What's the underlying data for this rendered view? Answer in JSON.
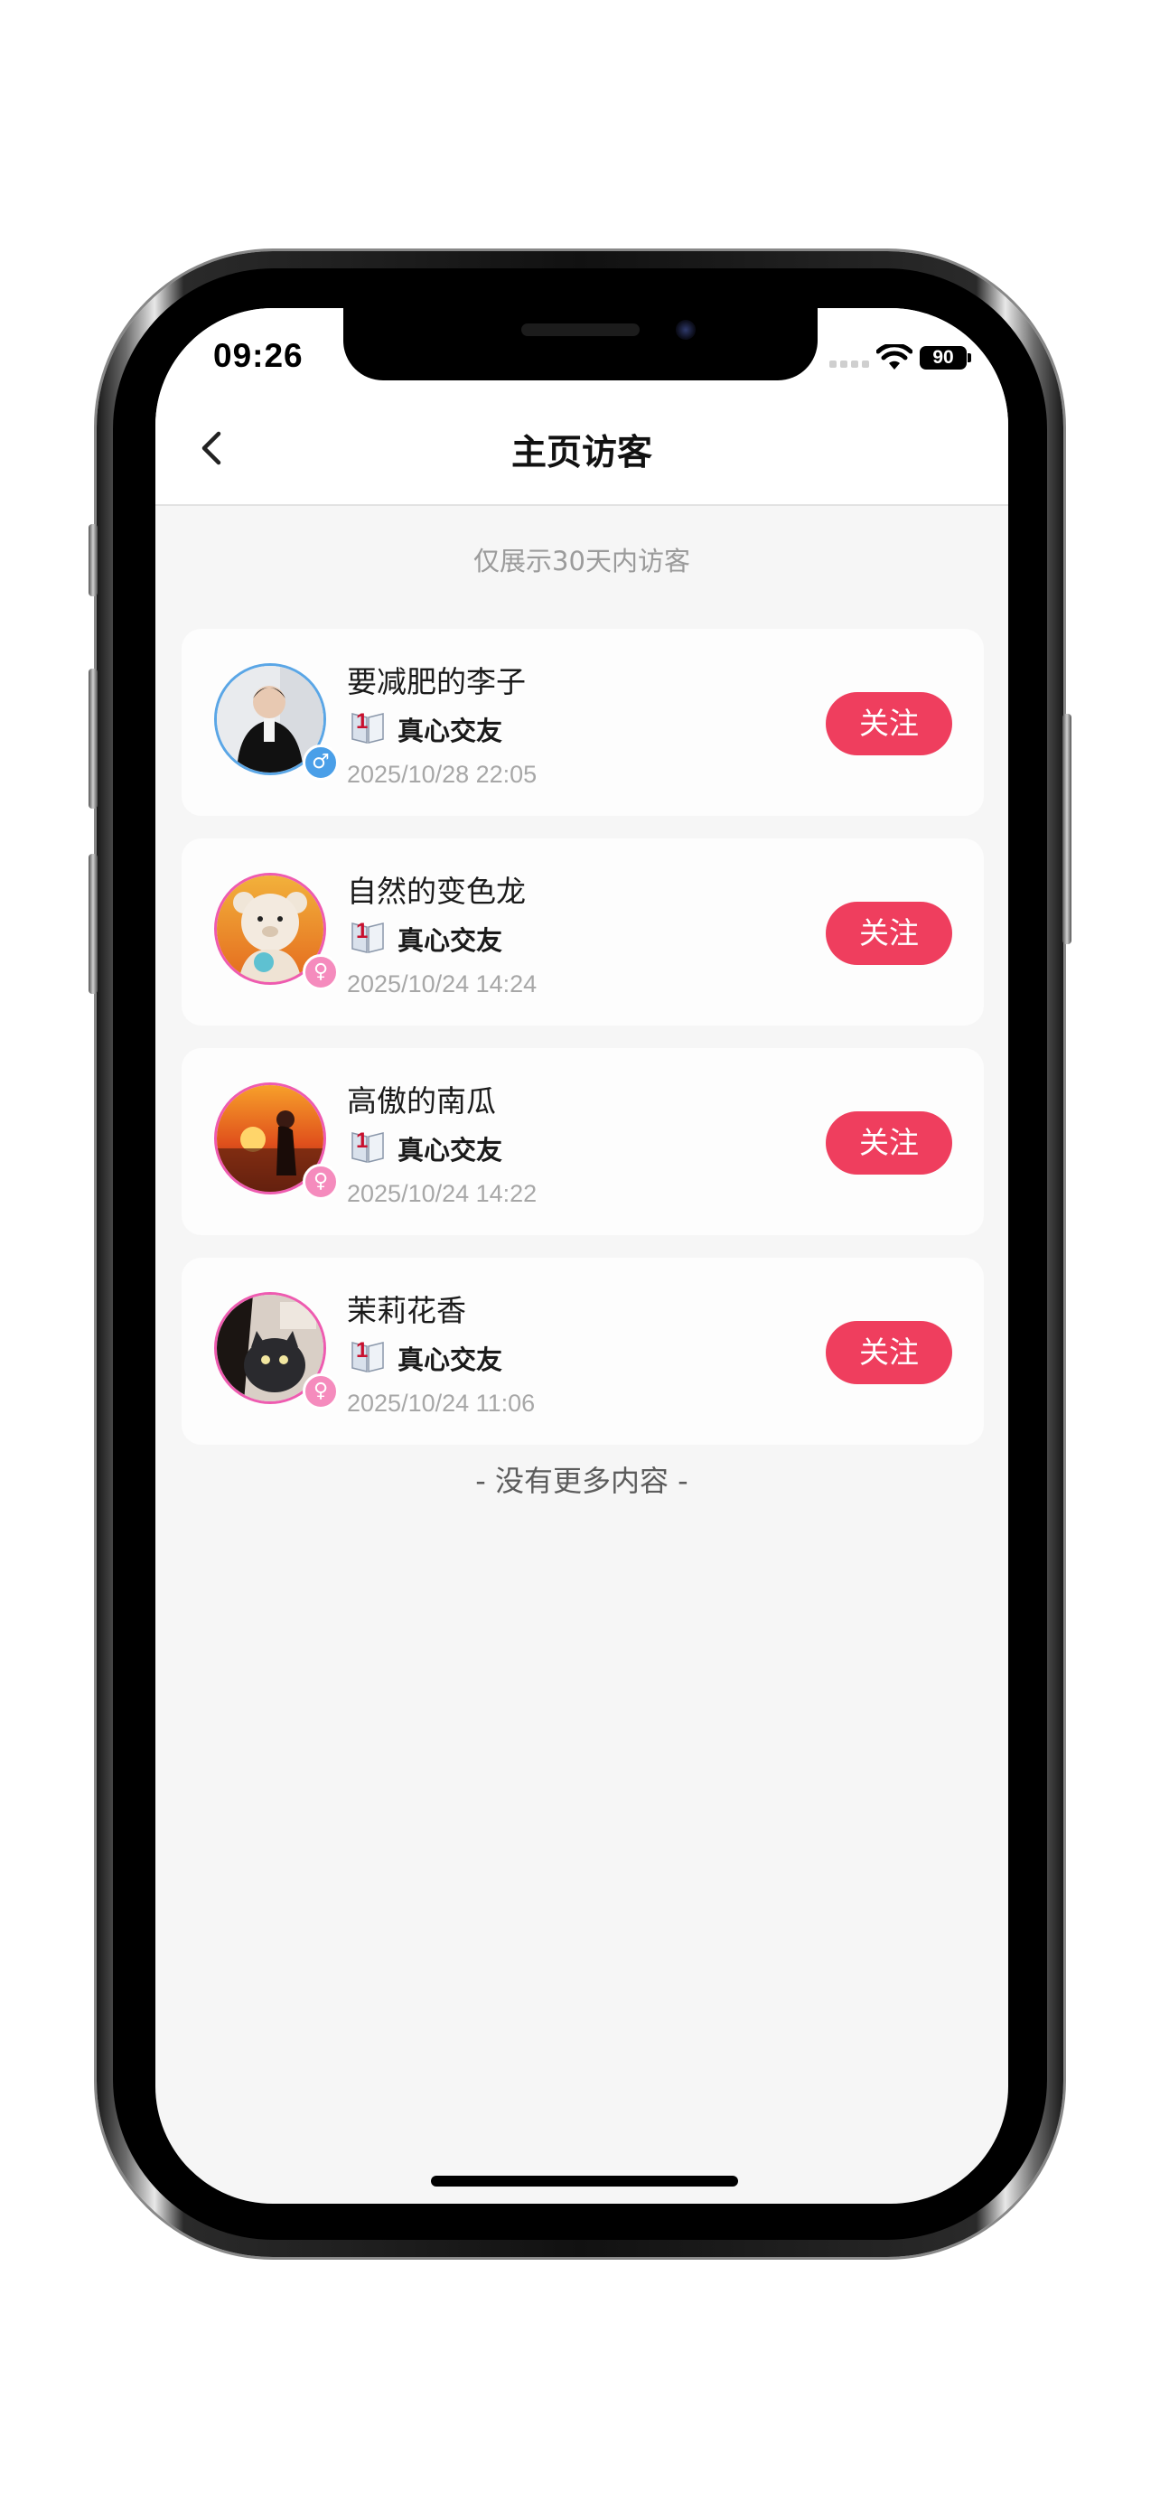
{
  "status_bar": {
    "time": "09:26",
    "battery": "90"
  },
  "nav": {
    "title": "主页访客"
  },
  "notice": "仅展示30天内访客",
  "visitors": [
    {
      "name": "要减肥的李子",
      "gender": "male",
      "gender_symbol": "♂",
      "badge_label": "真心交友",
      "datetime": "2025/10/28 22:05",
      "follow_label": "关注"
    },
    {
      "name": "自然的变色龙",
      "gender": "female",
      "gender_symbol": "♀",
      "badge_label": "真心交友",
      "datetime": "2025/10/24 14:24",
      "follow_label": "关注"
    },
    {
      "name": "高傲的南瓜",
      "gender": "female",
      "gender_symbol": "♀",
      "badge_label": "真心交友",
      "datetime": "2025/10/24 14:22",
      "follow_label": "关注"
    },
    {
      "name": "茉莉花香",
      "gender": "female",
      "gender_symbol": "♀",
      "badge_label": "真心交友",
      "datetime": "2025/10/24 11:06",
      "follow_label": "关注"
    }
  ],
  "end_text": "- 没有更多内容 -",
  "colors": {
    "accent": "#ef3e5e",
    "male": "#4a9fe8",
    "female": "#f58bbd"
  }
}
